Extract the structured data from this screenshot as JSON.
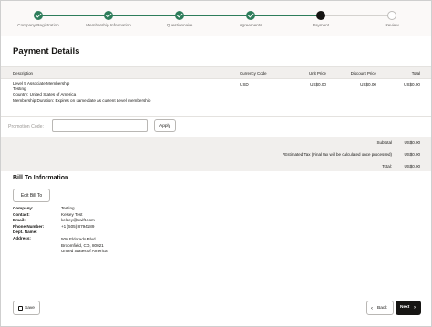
{
  "progress": {
    "steps": [
      {
        "label": "Company Registration",
        "state": "done"
      },
      {
        "label": "Membership Information",
        "state": "done"
      },
      {
        "label": "Questionnaire",
        "state": "done"
      },
      {
        "label": "Agreements",
        "state": "done"
      },
      {
        "label": "Payment",
        "state": "current"
      },
      {
        "label": "Review",
        "state": "todo"
      }
    ]
  },
  "page_title": "Payment Details",
  "table": {
    "headers": {
      "description": "Description",
      "currency": "Currency Code",
      "unit_price": "Unit Price",
      "discount": "Discount Price",
      "total": "Total"
    },
    "row": {
      "description_lines": [
        "Level 5 Associate Membership",
        "Testing",
        "Country: United States of America",
        "Membership Duration: Expires on same date as current Level membership"
      ],
      "currency": "USD",
      "unit_price": "US$0.00",
      "discount": "US$0.00",
      "total": "US$0.00"
    }
  },
  "promo": {
    "label": "Promotion Code:",
    "value": "",
    "apply_label": "Apply"
  },
  "totals": {
    "subtotal_label": "Subtotal",
    "subtotal_value": "US$0.00",
    "tax_label": "*Estimated Tax (Final tax will be calculated once processed)",
    "tax_value": "US$0.00",
    "total_label": "Total:",
    "total_value": "US$0.00"
  },
  "bill_to": {
    "title": "Bill To Information",
    "edit_label": "Edit Bill To",
    "fields": {
      "company_label": "Company:",
      "company": "Testing",
      "contact_label": "Contact:",
      "contact": "Kelsey Test",
      "email_label": "Email:",
      "email": "kelsey@swift.com",
      "phone_label": "Phone Number:",
      "phone": "+1 (505) 8794189",
      "dept_label": "Dept. Name:",
      "dept": "",
      "address_label": "Address:",
      "address_lines": [
        "500 Eldorado Blvd",
        "Broomfield, CO, 80021",
        "United States of America"
      ]
    }
  },
  "footer": {
    "save_label": "Save",
    "back_label": "Back",
    "next_label": "Next"
  },
  "colors": {
    "done": "#2e7d5b",
    "current": "#161513",
    "primary_button": "#161513"
  }
}
